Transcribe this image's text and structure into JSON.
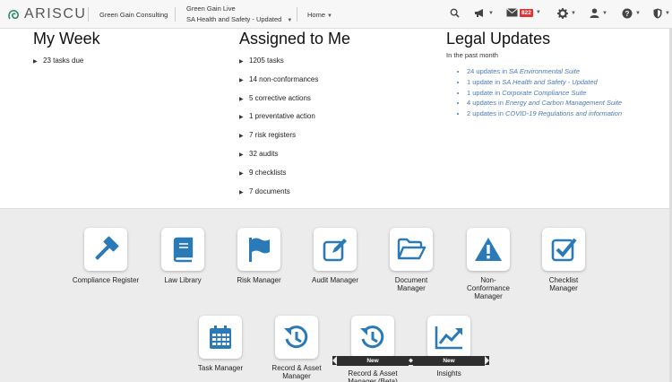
{
  "navbar": {
    "logo_text": "ARISCU",
    "org": "Green Gain Consulting",
    "site_line1": "Green Gain Live",
    "site_line2": "SA Health and Safety - Updated",
    "home": "Home",
    "inbox_badge": "822"
  },
  "my_week": {
    "title": "My Week",
    "items": [
      "23 tasks due"
    ]
  },
  "assigned": {
    "title": "Assigned to Me",
    "items": [
      "1205 tasks",
      "14 non-conformances",
      "5 corrective actions",
      "1 preventative action",
      "7 risk registers",
      "32 audits",
      "9 checklists",
      "7 documents"
    ]
  },
  "legal": {
    "title": "Legal Updates",
    "subtitle": "In the past month",
    "items": [
      {
        "count": "24 updates in ",
        "suite": "SA Environmental Suite"
      },
      {
        "count": "1 update in ",
        "suite": "SA Health and Safety - Updated"
      },
      {
        "count": "1 update in ",
        "suite": "Corporate Compliance Suite"
      },
      {
        "count": "4 updates in ",
        "suite": "Energy and Carbon Management Suite"
      },
      {
        "count": "2 updates in ",
        "suite": "COVID-19 Regulations and information"
      }
    ]
  },
  "apps": [
    {
      "label": "Compliance Register",
      "icon": "gavel-icon"
    },
    {
      "label": "Law Library",
      "icon": "book-icon"
    },
    {
      "label": "Risk Manager",
      "icon": "flag-icon"
    },
    {
      "label": "Audit Manager",
      "icon": "edit-icon"
    },
    {
      "label": "Document Manager",
      "icon": "folder-open-icon"
    },
    {
      "label": "Non-Conformance Manager",
      "icon": "warning-icon"
    },
    {
      "label": "Checklist Manager",
      "icon": "checkbox-icon"
    },
    {
      "label": "Task Manager",
      "icon": "calendar-icon"
    },
    {
      "label": "Record & Asset Manager",
      "icon": "history-icon"
    },
    {
      "label": "Record & Asset Manager (Beta)",
      "icon": "history-icon",
      "ribbon": "New"
    },
    {
      "label": "Insights",
      "icon": "line-chart-icon",
      "ribbon": "New"
    }
  ],
  "colors": {
    "accent": "#2a7ab8",
    "link": "#4a7ab5",
    "badge": "#dd3333"
  }
}
